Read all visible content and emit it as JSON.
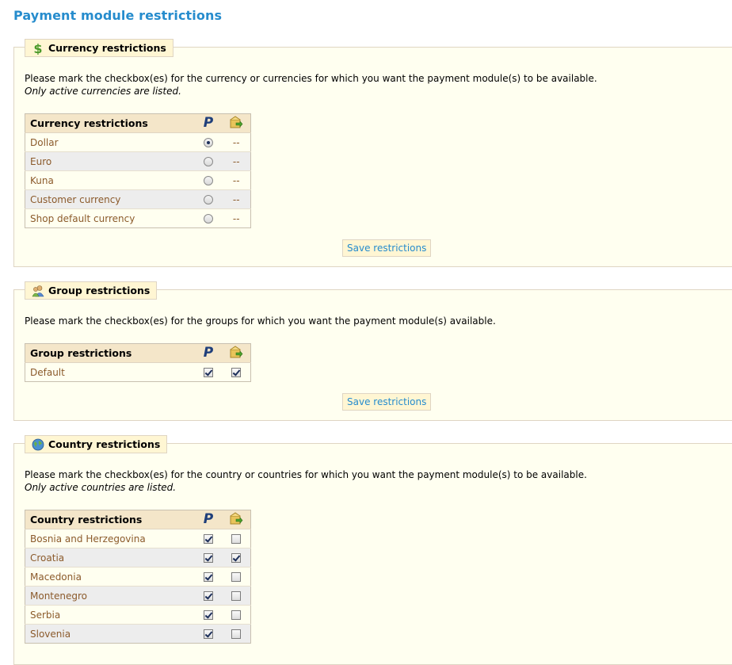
{
  "page_title": "Payment module restrictions",
  "colors": {
    "title": "#268ccd",
    "panel_bg": "#fffff0",
    "header_bg": "#f4e6c9",
    "link": "#268ccd"
  },
  "currency": {
    "legend": "Currency restrictions",
    "legend_icon": "dollar-icon",
    "desc": "Please mark the checkbox(es) for the currency or currencies for which you want the payment module(s) to be available.",
    "note": "Only active currencies are listed.",
    "table_header": "Currency restrictions",
    "col_icons": [
      "paypal-icon",
      "module-box-icon"
    ],
    "rows": [
      {
        "label": "Dollar",
        "paypal_selected": true,
        "other": "--"
      },
      {
        "label": "Euro",
        "paypal_selected": false,
        "other": "--"
      },
      {
        "label": "Kuna",
        "paypal_selected": false,
        "other": "--"
      },
      {
        "label": "Customer currency",
        "paypal_selected": false,
        "other": "--"
      },
      {
        "label": "Shop default currency",
        "paypal_selected": false,
        "other": "--"
      }
    ],
    "save_label": "Save restrictions"
  },
  "group": {
    "legend": "Group restrictions",
    "legend_icon": "group-icon",
    "desc": "Please mark the checkbox(es) for the groups for which you want the payment module(s) available.",
    "table_header": "Group restrictions",
    "rows": [
      {
        "label": "Default",
        "paypal": true,
        "other": true
      }
    ],
    "save_label": "Save restrictions"
  },
  "country": {
    "legend": "Country restrictions",
    "legend_icon": "globe-icon",
    "desc": "Please mark the checkbox(es) for the country or countries for which you want the payment module(s) to be available.",
    "note": "Only active countries are listed.",
    "table_header": "Country restrictions",
    "rows": [
      {
        "label": "Bosnia and Herzegovina",
        "paypal": true,
        "other": false
      },
      {
        "label": "Croatia",
        "paypal": true,
        "other": true
      },
      {
        "label": "Macedonia",
        "paypal": true,
        "other": false
      },
      {
        "label": "Montenegro",
        "paypal": true,
        "other": false
      },
      {
        "label": "Serbia",
        "paypal": true,
        "other": false
      },
      {
        "label": "Slovenia",
        "paypal": true,
        "other": false
      }
    ]
  }
}
